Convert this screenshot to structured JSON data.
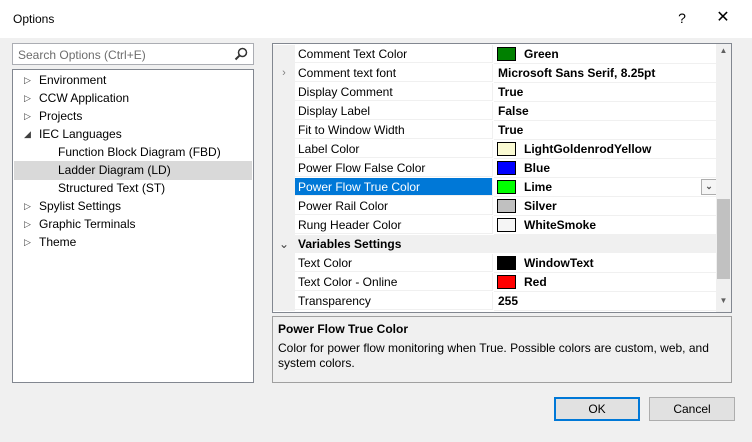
{
  "window": {
    "title": "Options",
    "help_glyph": "?",
    "close_glyph": "✕"
  },
  "search": {
    "placeholder": "Search Options (Ctrl+E)"
  },
  "tree": {
    "items": [
      {
        "label": "Environment",
        "arrow": "▷"
      },
      {
        "label": "CCW Application",
        "arrow": "▷"
      },
      {
        "label": "Projects",
        "arrow": "▷"
      },
      {
        "label": "IEC Languages",
        "arrow": "◢"
      },
      {
        "label": "Function Block Diagram (FBD)",
        "arrow": ""
      },
      {
        "label": "Ladder Diagram (LD)",
        "arrow": "",
        "selected": true
      },
      {
        "label": "Structured Text (ST)",
        "arrow": ""
      },
      {
        "label": "Spylist Settings",
        "arrow": "▷"
      },
      {
        "label": "Graphic Terminals",
        "arrow": "▷"
      },
      {
        "label": "Theme",
        "arrow": "▷"
      }
    ]
  },
  "grid": {
    "rows": [
      {
        "name": "Comment Text Color",
        "value": "Green",
        "swatch": "#008000"
      },
      {
        "name": "Comment text font",
        "value": "Microsoft Sans Serif, 8.25pt",
        "expander": "›"
      },
      {
        "name": "Display Comment",
        "value": "True"
      },
      {
        "name": "Display Label",
        "value": "False"
      },
      {
        "name": "Fit to Window Width",
        "value": "True"
      },
      {
        "name": "Label Color",
        "value": "LightGoldenrodYellow",
        "swatch": "#fafad2"
      },
      {
        "name": "Power Flow False Color",
        "value": "Blue",
        "swatch": "#0000ff"
      },
      {
        "name": "Power Flow True Color",
        "value": "Lime",
        "swatch": "#00ff00",
        "selected": true
      },
      {
        "name": "Power Rail Color",
        "value": "Silver",
        "swatch": "#c0c0c0"
      },
      {
        "name": "Rung Header Color",
        "value": "WhiteSmoke",
        "swatch": "#f5f5f5"
      },
      {
        "name": "Variables Settings",
        "category": true,
        "expander": "⌄"
      },
      {
        "name": "Text Color",
        "value": "WindowText",
        "swatch": "#000000"
      },
      {
        "name": "Text Color - Online",
        "value": "Red",
        "swatch": "#ff0000"
      },
      {
        "name": "Transparency",
        "value": "255"
      }
    ]
  },
  "description": {
    "title": "Power Flow True Color",
    "text": "Color for power flow monitoring when True. Possible colors are custom, web, and system colors."
  },
  "buttons": {
    "ok": "OK",
    "cancel": "Cancel"
  },
  "colors": {
    "selection": "#0078d7",
    "accent_button_border": "#0078d7"
  }
}
